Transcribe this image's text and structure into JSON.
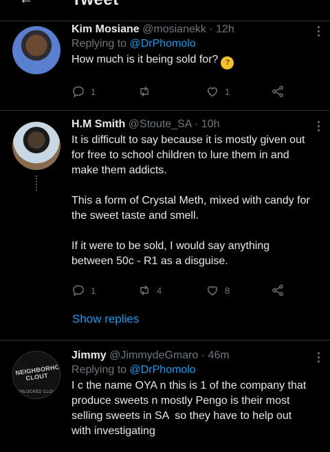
{
  "header": {
    "title": "Tweet"
  },
  "tweets": [
    {
      "name": "Kim Mosiane",
      "handle": "@mosianekk",
      "time": "12h",
      "replying_prefix": "Replying to",
      "replying_handle": "@DrPhomolo",
      "text": "How much is it being sold for?",
      "emoji": "thinking-face-emoji",
      "replies": "1",
      "retweets": "",
      "likes": "1"
    },
    {
      "name": "H.M Smith",
      "handle": "@Stoute_SA",
      "time": "10h",
      "text": "It is difficult to say because it is mostly given out for free to school children to lure them in and make them addicts.\n\nThis a form of Crystal Meth, mixed with candy for the sweet taste and smell.\n\nIf it were to be sold, I would say anything between 50c - R1 as a disguise.",
      "replies": "1",
      "retweets": "4",
      "likes": "8",
      "show_replies": "Show replies"
    },
    {
      "name": "Jimmy",
      "handle": "@JimmydeGmaro",
      "time": "46m",
      "replying_prefix": "Replying to",
      "replying_handle": "@DrPhomolo",
      "text": "I c the name OYA n this is 1 of the company that produce sweets n mostly Pengo is their most selling sweets in SA  so they have to help out with investigating",
      "avatar_text": "NEIGHBORHOOD CLOUT",
      "avatar_subtext": "UNLOCKED CLOUT"
    }
  ],
  "separator": "·"
}
